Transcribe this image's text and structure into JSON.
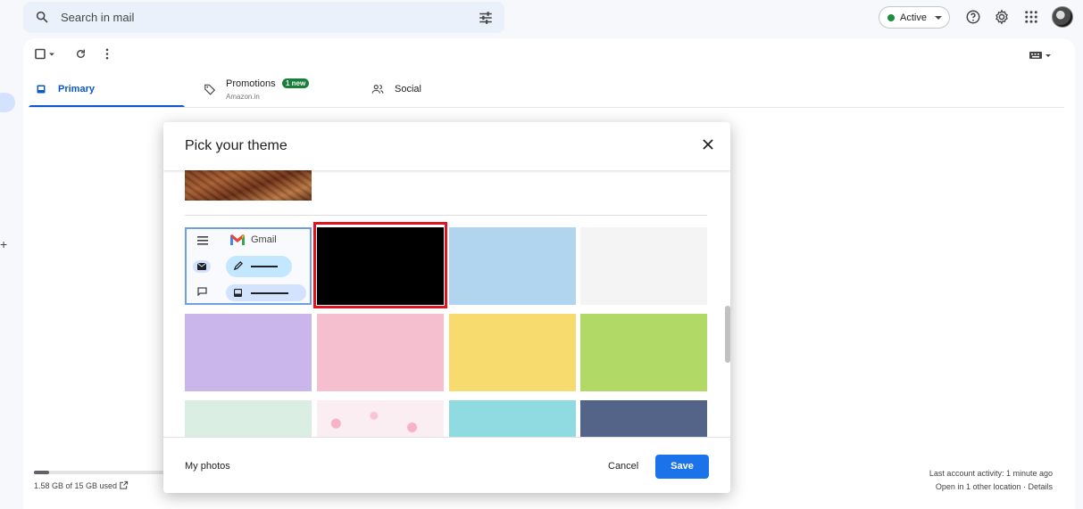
{
  "search": {
    "placeholder": "Search in mail"
  },
  "status": {
    "label": "Active",
    "color": "#1e8e3e"
  },
  "tabs": [
    {
      "label": "Primary",
      "icon": "inbox-icon",
      "selected": true
    },
    {
      "label": "Promotions",
      "badge": "1 new",
      "sublabel": "Amazon.in",
      "icon": "tag-icon"
    },
    {
      "label": "Social",
      "icon": "people-icon"
    }
  ],
  "storage": {
    "text": "1.58 GB of 15 GB used",
    "fraction": 0.105
  },
  "activity": {
    "line1": "Last account activity: 1 minute ago",
    "line2": "Open in 1 other location · Details"
  },
  "dialog": {
    "title": "Pick your theme",
    "default_tile": {
      "app_name": "Gmail"
    },
    "themes": [
      {
        "name": "default",
        "color": "#f8fafd"
      },
      {
        "name": "black",
        "color": "#000000",
        "selected": true
      },
      {
        "name": "light-blue",
        "color": "#b2d5ef"
      },
      {
        "name": "light-gray",
        "color": "#f4f4f4"
      },
      {
        "name": "lavender",
        "color": "#cbb6ec"
      },
      {
        "name": "pink",
        "color": "#f5bfcf"
      },
      {
        "name": "yellow",
        "color": "#f7db6f"
      },
      {
        "name": "green",
        "color": "#b0d966"
      },
      {
        "name": "mint",
        "color": "#dbeee4"
      },
      {
        "name": "cherry-blossom",
        "color": "#fbeef2"
      },
      {
        "name": "teal",
        "color": "#8fdbe1"
      },
      {
        "name": "slate-blue",
        "color": "#546489"
      }
    ],
    "footer": {
      "my_photos": "My photos",
      "cancel": "Cancel",
      "save": "Save"
    }
  }
}
